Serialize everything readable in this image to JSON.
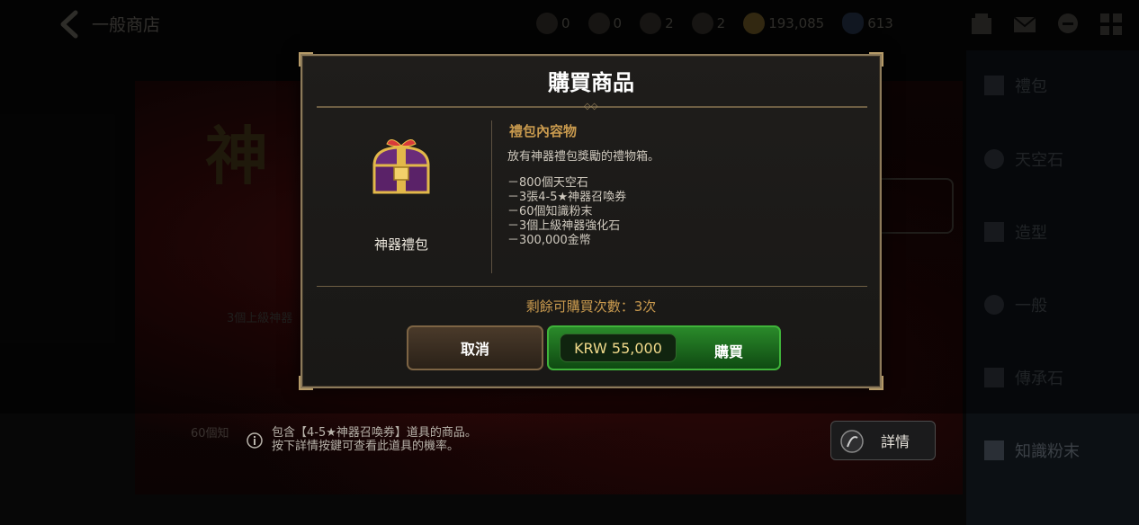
{
  "topbar": {
    "title": "一般商店",
    "currencies": [
      {
        "icon": "sky-stone-fragment-icon",
        "value": "0"
      },
      {
        "icon": "red-orb-icon",
        "value": "0"
      },
      {
        "icon": "artifact-fragment-icon",
        "value": "2"
      },
      {
        "icon": "feather-icon",
        "value": "2"
      },
      {
        "icon": "gold-coin-icon",
        "value": "193,085"
      },
      {
        "icon": "gem-icon",
        "value": "613"
      }
    ]
  },
  "sidebar": {
    "items": [
      {
        "label": "禮包",
        "icon": "gift-icon"
      },
      {
        "label": "天空石",
        "icon": "sky-stone-icon"
      },
      {
        "label": "造型",
        "icon": "costume-icon"
      },
      {
        "label": "一般",
        "icon": "globe-icon"
      },
      {
        "label": "傳承石",
        "icon": "heritage-stone-icon"
      },
      {
        "label": "知識粉末",
        "icon": "knowledge-powder-icon"
      }
    ]
  },
  "background": {
    "big_title": "神",
    "sub_text": "3個上級神器",
    "count_text": "60個知"
  },
  "notice": {
    "line1": "包含【4-5★神器召喚券】道具的商品。",
    "line2": "按下詳情按鍵可查看此道具的機率。",
    "detail_button": "詳情"
  },
  "modal": {
    "title": "購買商品",
    "item_name": "神器禮包",
    "contents_heading": "禮包內容物",
    "description": "放有神器禮包獎勵的禮物箱。",
    "contents": [
      "－800個天空石",
      "－3張4-5★神器召喚券",
      "－60個知識粉末",
      "－3個上級神器強化石",
      "－300,000金幣"
    ],
    "remaining": "剩餘可購買次數：3次",
    "cancel_label": "取消",
    "price": "KRW 55,000",
    "buy_label": "購買"
  }
}
